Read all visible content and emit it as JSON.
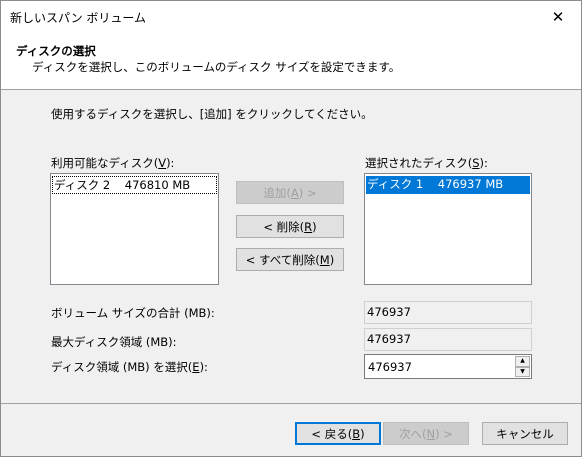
{
  "window": {
    "title": "新しいスパン ボリューム",
    "close_glyph": "✕"
  },
  "header": {
    "title": "ディスクの選択",
    "subtitle": "ディスクを選択し、このボリュームのディスク サイズを設定できます。"
  },
  "instruction": "使用するディスクを選択し、[追加] をクリックしてください。",
  "available": {
    "label_pre": "利用可能なディスク(",
    "label_key": "V",
    "label_post": "):",
    "items": [
      "ディスク 2    476810 MB"
    ]
  },
  "selected": {
    "label_pre": "選択されたディスク(",
    "label_key": "S",
    "label_post": "):",
    "items": [
      "ディスク 1    476937 MB"
    ]
  },
  "buttons": {
    "add": {
      "pre": "追加(",
      "key": "A",
      "post": ") >"
    },
    "remove": {
      "pre": "< 削除(",
      "key": "R",
      "post": ")"
    },
    "remove_all": {
      "pre": "< すべて削除(",
      "key": "M",
      "post": ")"
    },
    "back": {
      "pre": "< 戻る(",
      "key": "B",
      "post": ")"
    },
    "next": {
      "pre": "次へ(",
      "key": "N",
      "post": ") >"
    },
    "cancel": "キャンセル"
  },
  "fields": {
    "total_label": "ボリューム サイズの合計 (MB):",
    "total_value": "476937",
    "max_label": "最大ディスク領域 (MB):",
    "max_value": "476937",
    "select_label_pre": "ディスク領域 (MB) を選択(",
    "select_label_key": "E",
    "select_label_post": "):",
    "select_value": "476937"
  }
}
